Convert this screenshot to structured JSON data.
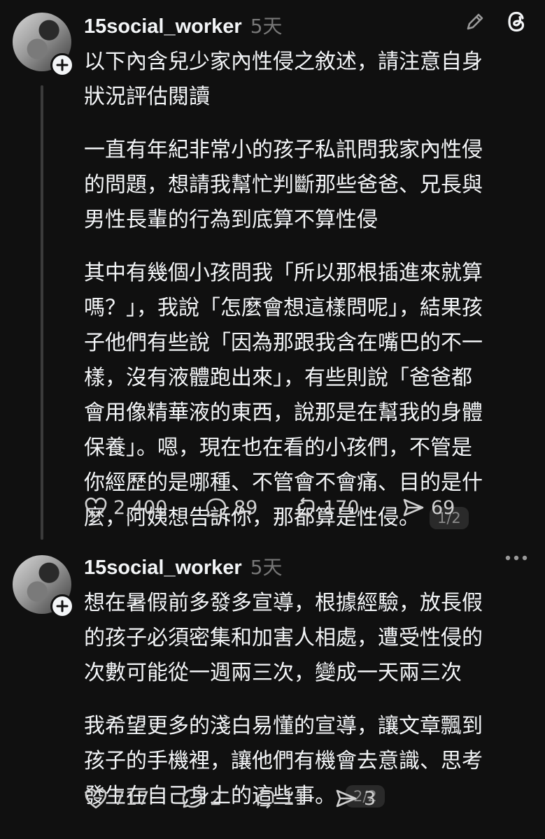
{
  "posts": [
    {
      "username": "15social_worker",
      "time": "5天",
      "paragraphs": [
        "以下內含兒少家內性侵之敘述，請注意自身\n狀況評估閱讀",
        "一直有年紀非常小的孩子私訊問我家內性侵\n的問題，想請我幫忙判斷那些爸爸、兄長與\n男性長輩的行為到底算不算性侵",
        "其中有幾個小孩問我「所以那根插進來就算\n嗎？」，我說「怎麼會想這樣問呢」，結果孩\n子他們有些說「因為那跟我含在嘴巴的不一\n樣，沒有液體跑出來」，有些則說「爸爸都\n會用像精華液的東西，說那是在幫我的身體\n保養」。嗯，現在也在看的小孩們，不管是\n你經歷的是哪種、不管會不會痛、目的是什\n麼，阿姨想告訴你，那都算是性侵。"
      ],
      "page": "1/2",
      "likes": "2,400",
      "replies": "89",
      "reposts": "170",
      "shares": "69"
    },
    {
      "username": "15social_worker",
      "time": "5天",
      "paragraphs": [
        "想在暑假前多發多宣導，根據經驗，放長假\n的孩子必須密集和加害人相處，遭受性侵的\n次數可能從一週兩三次，變成一天兩三次",
        "我希望更多的淺白易懂的宣導，讓文章飄到\n孩子的手機裡，讓他們有機會去意識、思考\n發生在自己身上的這些事。"
      ],
      "page": "2/2",
      "likes": "717",
      "replies": "2",
      "reposts": "11",
      "shares": "3"
    }
  ],
  "icons": {
    "post1_header": [
      "pencil-icon",
      "threads-logo-icon"
    ],
    "post2_header": [
      "more-options-icon"
    ],
    "actions": [
      "heart-icon",
      "comment-icon",
      "repost-icon",
      "share-icon"
    ]
  },
  "colors": {
    "background": "#101010",
    "text": "#f3f5f7",
    "muted": "#777777"
  }
}
